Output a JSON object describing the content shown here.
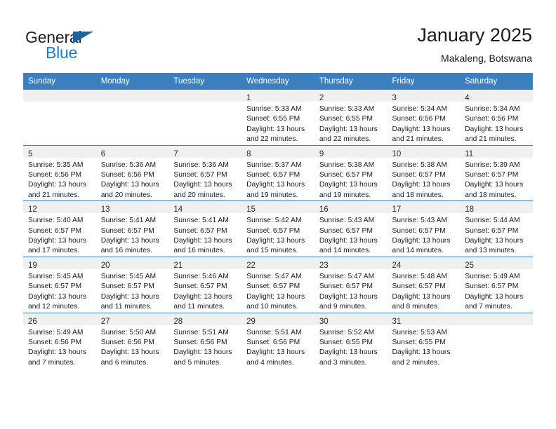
{
  "brand": {
    "name_part1": "General",
    "name_part2": "Blue",
    "triangle_color": "#1565a8",
    "blue_color": "#1a7ec8"
  },
  "header": {
    "title": "January 2025",
    "subtitle": "Makaleng, Botswana"
  },
  "theme": {
    "header_row_bg": "#3c7fbe",
    "daynum_band_bg": "#f0f0f0",
    "row_divider": "#3c7fbe"
  },
  "weekdays": [
    "Sunday",
    "Monday",
    "Tuesday",
    "Wednesday",
    "Thursday",
    "Friday",
    "Saturday"
  ],
  "weeks": [
    [
      {
        "empty": true
      },
      {
        "empty": true
      },
      {
        "empty": true
      },
      {
        "day": "1",
        "sunrise": "Sunrise: 5:33 AM",
        "sunset": "Sunset: 6:55 PM",
        "daylight1": "Daylight: 13 hours",
        "daylight2": "and 22 minutes."
      },
      {
        "day": "2",
        "sunrise": "Sunrise: 5:33 AM",
        "sunset": "Sunset: 6:55 PM",
        "daylight1": "Daylight: 13 hours",
        "daylight2": "and 22 minutes."
      },
      {
        "day": "3",
        "sunrise": "Sunrise: 5:34 AM",
        "sunset": "Sunset: 6:56 PM",
        "daylight1": "Daylight: 13 hours",
        "daylight2": "and 21 minutes."
      },
      {
        "day": "4",
        "sunrise": "Sunrise: 5:34 AM",
        "sunset": "Sunset: 6:56 PM",
        "daylight1": "Daylight: 13 hours",
        "daylight2": "and 21 minutes."
      }
    ],
    [
      {
        "day": "5",
        "sunrise": "Sunrise: 5:35 AM",
        "sunset": "Sunset: 6:56 PM",
        "daylight1": "Daylight: 13 hours",
        "daylight2": "and 21 minutes."
      },
      {
        "day": "6",
        "sunrise": "Sunrise: 5:36 AM",
        "sunset": "Sunset: 6:56 PM",
        "daylight1": "Daylight: 13 hours",
        "daylight2": "and 20 minutes."
      },
      {
        "day": "7",
        "sunrise": "Sunrise: 5:36 AM",
        "sunset": "Sunset: 6:57 PM",
        "daylight1": "Daylight: 13 hours",
        "daylight2": "and 20 minutes."
      },
      {
        "day": "8",
        "sunrise": "Sunrise: 5:37 AM",
        "sunset": "Sunset: 6:57 PM",
        "daylight1": "Daylight: 13 hours",
        "daylight2": "and 19 minutes."
      },
      {
        "day": "9",
        "sunrise": "Sunrise: 5:38 AM",
        "sunset": "Sunset: 6:57 PM",
        "daylight1": "Daylight: 13 hours",
        "daylight2": "and 19 minutes."
      },
      {
        "day": "10",
        "sunrise": "Sunrise: 5:38 AM",
        "sunset": "Sunset: 6:57 PM",
        "daylight1": "Daylight: 13 hours",
        "daylight2": "and 18 minutes."
      },
      {
        "day": "11",
        "sunrise": "Sunrise: 5:39 AM",
        "sunset": "Sunset: 6:57 PM",
        "daylight1": "Daylight: 13 hours",
        "daylight2": "and 18 minutes."
      }
    ],
    [
      {
        "day": "12",
        "sunrise": "Sunrise: 5:40 AM",
        "sunset": "Sunset: 6:57 PM",
        "daylight1": "Daylight: 13 hours",
        "daylight2": "and 17 minutes."
      },
      {
        "day": "13",
        "sunrise": "Sunrise: 5:41 AM",
        "sunset": "Sunset: 6:57 PM",
        "daylight1": "Daylight: 13 hours",
        "daylight2": "and 16 minutes."
      },
      {
        "day": "14",
        "sunrise": "Sunrise: 5:41 AM",
        "sunset": "Sunset: 6:57 PM",
        "daylight1": "Daylight: 13 hours",
        "daylight2": "and 16 minutes."
      },
      {
        "day": "15",
        "sunrise": "Sunrise: 5:42 AM",
        "sunset": "Sunset: 6:57 PM",
        "daylight1": "Daylight: 13 hours",
        "daylight2": "and 15 minutes."
      },
      {
        "day": "16",
        "sunrise": "Sunrise: 5:43 AM",
        "sunset": "Sunset: 6:57 PM",
        "daylight1": "Daylight: 13 hours",
        "daylight2": "and 14 minutes."
      },
      {
        "day": "17",
        "sunrise": "Sunrise: 5:43 AM",
        "sunset": "Sunset: 6:57 PM",
        "daylight1": "Daylight: 13 hours",
        "daylight2": "and 14 minutes."
      },
      {
        "day": "18",
        "sunrise": "Sunrise: 5:44 AM",
        "sunset": "Sunset: 6:57 PM",
        "daylight1": "Daylight: 13 hours",
        "daylight2": "and 13 minutes."
      }
    ],
    [
      {
        "day": "19",
        "sunrise": "Sunrise: 5:45 AM",
        "sunset": "Sunset: 6:57 PM",
        "daylight1": "Daylight: 13 hours",
        "daylight2": "and 12 minutes."
      },
      {
        "day": "20",
        "sunrise": "Sunrise: 5:45 AM",
        "sunset": "Sunset: 6:57 PM",
        "daylight1": "Daylight: 13 hours",
        "daylight2": "and 11 minutes."
      },
      {
        "day": "21",
        "sunrise": "Sunrise: 5:46 AM",
        "sunset": "Sunset: 6:57 PM",
        "daylight1": "Daylight: 13 hours",
        "daylight2": "and 11 minutes."
      },
      {
        "day": "22",
        "sunrise": "Sunrise: 5:47 AM",
        "sunset": "Sunset: 6:57 PM",
        "daylight1": "Daylight: 13 hours",
        "daylight2": "and 10 minutes."
      },
      {
        "day": "23",
        "sunrise": "Sunrise: 5:47 AM",
        "sunset": "Sunset: 6:57 PM",
        "daylight1": "Daylight: 13 hours",
        "daylight2": "and 9 minutes."
      },
      {
        "day": "24",
        "sunrise": "Sunrise: 5:48 AM",
        "sunset": "Sunset: 6:57 PM",
        "daylight1": "Daylight: 13 hours",
        "daylight2": "and 8 minutes."
      },
      {
        "day": "25",
        "sunrise": "Sunrise: 5:49 AM",
        "sunset": "Sunset: 6:57 PM",
        "daylight1": "Daylight: 13 hours",
        "daylight2": "and 7 minutes."
      }
    ],
    [
      {
        "day": "26",
        "sunrise": "Sunrise: 5:49 AM",
        "sunset": "Sunset: 6:56 PM",
        "daylight1": "Daylight: 13 hours",
        "daylight2": "and 7 minutes."
      },
      {
        "day": "27",
        "sunrise": "Sunrise: 5:50 AM",
        "sunset": "Sunset: 6:56 PM",
        "daylight1": "Daylight: 13 hours",
        "daylight2": "and 6 minutes."
      },
      {
        "day": "28",
        "sunrise": "Sunrise: 5:51 AM",
        "sunset": "Sunset: 6:56 PM",
        "daylight1": "Daylight: 13 hours",
        "daylight2": "and 5 minutes."
      },
      {
        "day": "29",
        "sunrise": "Sunrise: 5:51 AM",
        "sunset": "Sunset: 6:56 PM",
        "daylight1": "Daylight: 13 hours",
        "daylight2": "and 4 minutes."
      },
      {
        "day": "30",
        "sunrise": "Sunrise: 5:52 AM",
        "sunset": "Sunset: 6:55 PM",
        "daylight1": "Daylight: 13 hours",
        "daylight2": "and 3 minutes."
      },
      {
        "day": "31",
        "sunrise": "Sunrise: 5:53 AM",
        "sunset": "Sunset: 6:55 PM",
        "daylight1": "Daylight: 13 hours",
        "daylight2": "and 2 minutes."
      },
      {
        "empty": true
      }
    ]
  ]
}
